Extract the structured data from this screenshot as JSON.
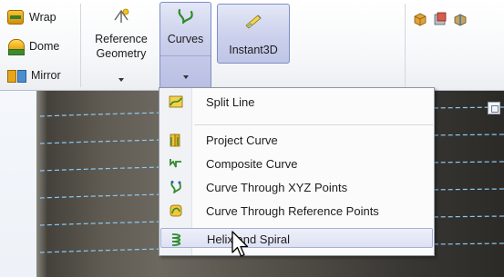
{
  "ribbon": {
    "small_buttons": [
      {
        "label": "Wrap",
        "icon": "wrap-icon"
      },
      {
        "label": "Dome",
        "icon": "dome-icon"
      },
      {
        "label": "Mirror",
        "icon": "mirror-icon"
      }
    ],
    "reference_geometry": {
      "line1": "Reference",
      "line2": "Geometry",
      "icon": "reference-geometry-icon"
    },
    "curves": {
      "label": "Curves",
      "icon": "curves-icon",
      "state": "open"
    },
    "instant3d": {
      "label": "Instant3D",
      "icon": "instant3d-icon"
    },
    "right_icons": [
      "view-orientation-icon",
      "display-style-icon",
      "section-view-icon"
    ]
  },
  "curves_menu": {
    "items": [
      {
        "label": "Split Line",
        "icon": "split-line-icon"
      },
      {
        "label": "Project Curve",
        "icon": "project-curve-icon"
      },
      {
        "label": "Composite Curve",
        "icon": "composite-curve-icon"
      },
      {
        "label": "Curve Through XYZ Points",
        "icon": "curve-xyz-points-icon"
      },
      {
        "label": "Curve Through Reference Points",
        "icon": "curve-reference-points-icon"
      },
      {
        "label": "Helix and Spiral",
        "icon": "helix-spiral-icon",
        "highlighted": true
      }
    ]
  },
  "colors": {
    "menu_highlight": "#dde1f3",
    "active_tab": "#c8cdea",
    "helix_line": "#8ec8f0",
    "cylinder": "#5f5b52"
  }
}
